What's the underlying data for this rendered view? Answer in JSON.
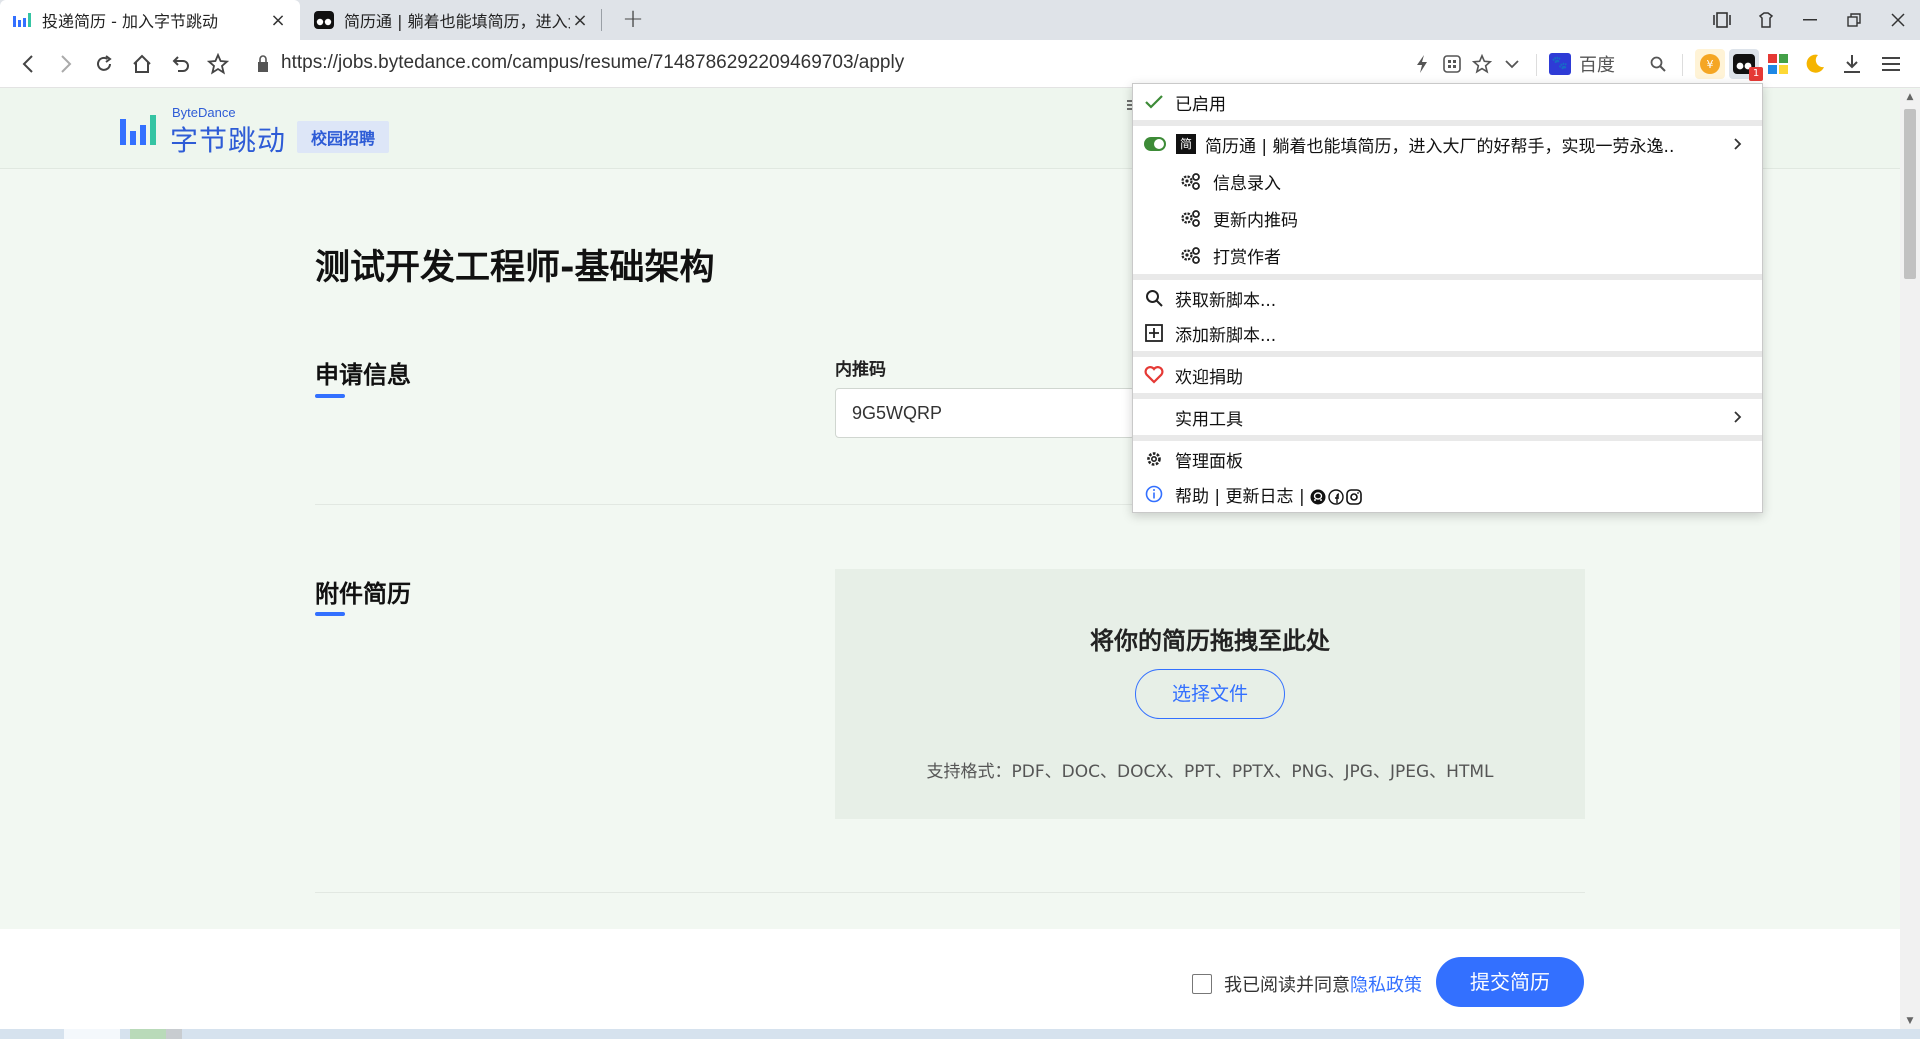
{
  "tabs": [
    {
      "title": "投递简历 - 加入字节跳动",
      "close": "×"
    },
    {
      "title": "简历通 | 躺着也能填简历，进入大厂的好帮手",
      "close": "×"
    }
  ],
  "new_tab": "+",
  "address": {
    "url": "https://jobs.bytedance.com/campus/resume/7148786292209469703/apply",
    "search_engine": "百度"
  },
  "extension_badge": "1",
  "site": {
    "logo_en": "ByteDance",
    "logo_cn": "字节跳动",
    "campus": "校园招聘",
    "hint": "ヽ"
  },
  "job": {
    "title": "测试开发工程师-基础架构"
  },
  "application": {
    "section_title": "申请信息",
    "referral_label": "内推码",
    "referral_value": "9G5WQRP"
  },
  "attachment": {
    "section_title": "附件简历",
    "drop_title": "将你的简历拖拽至此处",
    "choose_button": "选择文件",
    "formats": "支持格式：PDF、DOC、DOCX、PPT、PPTX、PNG、JPG、JPEG、HTML"
  },
  "footer": {
    "agree_prefix": "我已阅读并同意",
    "privacy_link": "隐私政策",
    "submit": "提交简历"
  },
  "tm_menu": {
    "enabled": "已启用",
    "script_icon": "简",
    "script_name": "简历通 | 躺着也能填简历，进入大厂的好帮手，实现一劳永逸...",
    "commands": [
      "信息录入",
      "更新内推码",
      "打赏作者"
    ],
    "get_scripts": "获取新脚本...",
    "add_script": "添加新脚本...",
    "donate": "欢迎捐助",
    "utilities": "实用工具",
    "dashboard": "管理面板",
    "help": "帮助 | 更新日志 |"
  },
  "colors": {
    "accent": "#3370ff",
    "toggle_on": "#3d8b37",
    "heart": "#e53935"
  }
}
